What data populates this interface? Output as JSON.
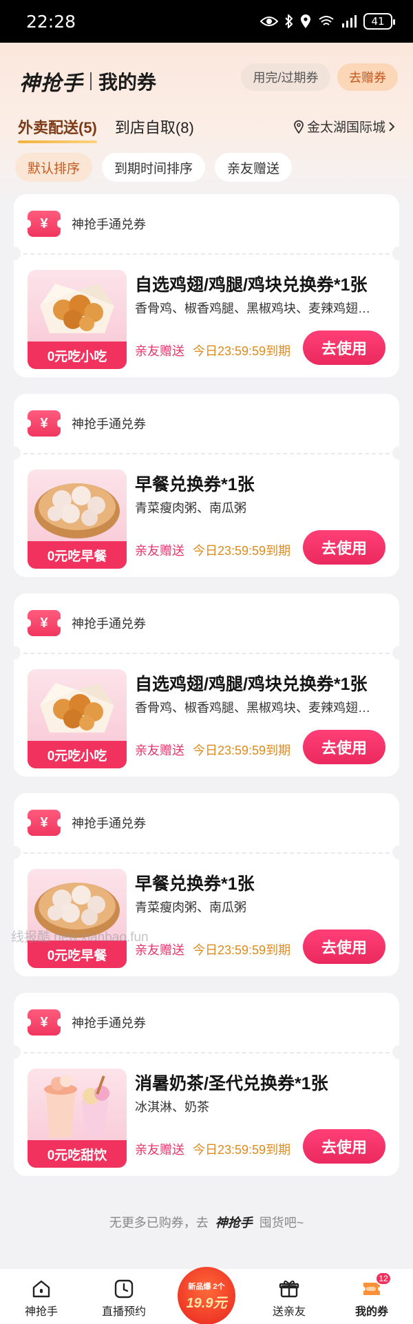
{
  "status_bar": {
    "time": "22:28",
    "battery": "41"
  },
  "header": {
    "brand": "神抢手",
    "title": "我的券",
    "expired_button": "用完/过期券",
    "gift_button": "去赠券"
  },
  "tabs": [
    {
      "label": "外卖配送(5)",
      "active": true
    },
    {
      "label": "到店自取(8)",
      "active": false
    }
  ],
  "location": "金太湖国际城",
  "sort_options": [
    {
      "label": "默认排序",
      "active": true
    },
    {
      "label": "到期时间排序",
      "active": false
    },
    {
      "label": "亲友赠送",
      "active": false
    }
  ],
  "coupons": [
    {
      "type": "神抢手通兑券",
      "title": "自选鸡翅/鸡腿/鸡块兑换券*1张",
      "desc": "香骨鸡、椒香鸡腿、黑椒鸡块、麦辣鸡翅…",
      "thumb_label": "0元吃小吃",
      "thumb_icon": "fried-chicken",
      "gift": "亲友赠送",
      "expiry": "今日23:59:59到期",
      "button": "去使用"
    },
    {
      "type": "神抢手通兑券",
      "title": "早餐兑换券*1张",
      "desc": "青菜瘦肉粥、南瓜粥",
      "thumb_label": "0元吃早餐",
      "thumb_icon": "steamed-buns",
      "gift": "亲友赠送",
      "expiry": "今日23:59:59到期",
      "button": "去使用"
    },
    {
      "type": "神抢手通兑券",
      "title": "自选鸡翅/鸡腿/鸡块兑换券*1张",
      "desc": "香骨鸡、椒香鸡腿、黑椒鸡块、麦辣鸡翅…",
      "thumb_label": "0元吃小吃",
      "thumb_icon": "fried-chicken",
      "gift": "亲友赠送",
      "expiry": "今日23:59:59到期",
      "button": "去使用"
    },
    {
      "type": "神抢手通兑券",
      "title": "早餐兑换券*1张",
      "desc": "青菜瘦肉粥、南瓜粥",
      "thumb_label": "0元吃早餐",
      "thumb_icon": "steamed-buns",
      "gift": "亲友赠送",
      "expiry": "今日23:59:59到期",
      "button": "去使用"
    },
    {
      "type": "神抢手通兑券",
      "title": "消暑奶茶/圣代兑换券*1张",
      "desc": "冰淇淋、奶茶",
      "thumb_label": "0元吃甜饮",
      "thumb_icon": "milk-tea",
      "gift": "亲友赠送",
      "expiry": "今日23:59:59到期",
      "button": "去使用"
    }
  ],
  "watermark": "线报酷 new.xianbao.fun",
  "footer": {
    "prefix": "无更多已购券，去",
    "brand": "神抢手",
    "suffix": "囤货吧~"
  },
  "tabbar": {
    "items": [
      {
        "label": "神抢手",
        "icon": "home-icon"
      },
      {
        "label": "直播预约",
        "icon": "clock-icon"
      },
      {
        "label": "送亲友",
        "icon": "gift-icon"
      },
      {
        "label": "我的券",
        "icon": "coupon-icon",
        "badge": "12",
        "active": true
      }
    ],
    "center": {
      "line1": "新品爆",
      "line2": "2个",
      "price": "19.9元"
    }
  },
  "colors": {
    "accent": "#f2325e",
    "expiry": "#e08a1c",
    "tab_active": "#7d3a17"
  }
}
